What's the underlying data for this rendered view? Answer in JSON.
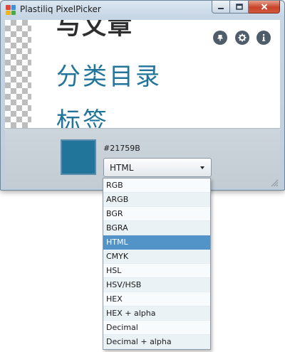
{
  "window": {
    "title": "Plastiliq PixelPicker",
    "app_icon_colors": [
      "#e1463a",
      "#3d8fd6",
      "#f2b51f",
      "#4aa84a"
    ],
    "caption_buttons": [
      "minimize-icon",
      "maximize-icon",
      "close-icon"
    ]
  },
  "magnifier": {
    "lines": [
      "与文章",
      "分类目录",
      "标签"
    ],
    "accent_color": "#21759b"
  },
  "toolbar": {
    "icons": [
      "pin-icon",
      "gear-icon",
      "info-icon"
    ]
  },
  "color": {
    "swatch": "#21759b",
    "hex_value": "#21759B"
  },
  "format": {
    "selected": "HTML",
    "options": [
      "RGB",
      "ARGB",
      "BGR",
      "BGRA",
      "HTML",
      "CMYK",
      "HSL",
      "HSV/HSB",
      "HEX",
      "HEX + alpha",
      "Decimal",
      "Decimal + alpha"
    ]
  }
}
